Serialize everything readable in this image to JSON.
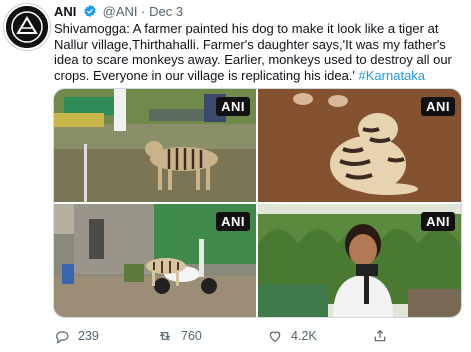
{
  "tweet": {
    "display_name": "ANI",
    "handle": "@ANI",
    "separator": "·",
    "date": "Dec 3",
    "text": "Shivamogga: A farmer painted his dog to make it look like a tiger at Nallur village,Thirthahalli. Farmer's daughter says,'It was my father's idea to scare monkeys away. Earlier, monkeys used to destroy all our crops. Everyone in our village is replicating his idea.' ",
    "hashtag": "#Karnataka",
    "avatar_logo_text": "ANI"
  },
  "media": {
    "watermark": "ANI",
    "tiles": [
      {
        "name": "farm-dog-photo"
      },
      {
        "name": "painted-dog-closeup-photo"
      },
      {
        "name": "dog-by-scooter-photo"
      },
      {
        "name": "reporter-photo"
      }
    ]
  },
  "actions": {
    "reply_count": "239",
    "retweet_count": "760",
    "like_count": "4.2K"
  },
  "colors": {
    "link": "#1d9bf0",
    "muted": "#536471",
    "verified": "#1d9bf0"
  },
  "icons": [
    "verified-badge-icon",
    "reply-icon",
    "retweet-icon",
    "like-icon",
    "share-icon"
  ]
}
